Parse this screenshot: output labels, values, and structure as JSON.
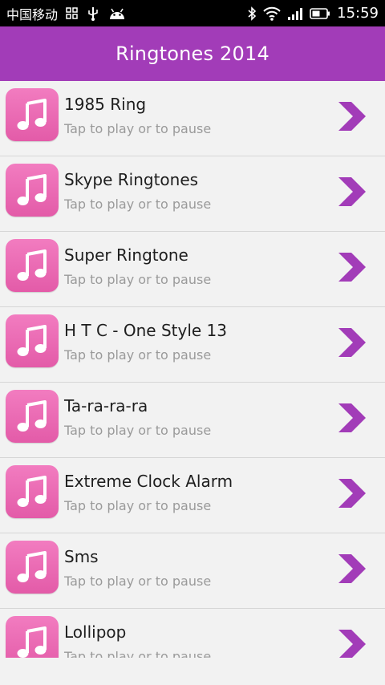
{
  "status_bar": {
    "carrier": "中国移动",
    "time": "15:59",
    "left_icons": [
      "notification-grid-icon",
      "usb-icon",
      "android-icon"
    ],
    "right_icons": [
      "bluetooth-icon",
      "wifi-icon",
      "signal-icon",
      "battery-icon"
    ]
  },
  "app_bar": {
    "title": "Ringtones 2014",
    "color": "#a23cb8"
  },
  "list": {
    "items": [
      {
        "title": "1985 Ring",
        "subtitle": "Tap to play or to pause"
      },
      {
        "title": "Skype Ringtones",
        "subtitle": "Tap to play or to pause"
      },
      {
        "title": "Super Ringtone",
        "subtitle": "Tap to play or to pause"
      },
      {
        "title": "H T C - One Style 13",
        "subtitle": "Tap to play or to pause"
      },
      {
        "title": "Ta-ra-ra-ra",
        "subtitle": "Tap to play or to pause"
      },
      {
        "title": "Extreme Clock Alarm",
        "subtitle": "Tap to play or to pause"
      },
      {
        "title": "Sms",
        "subtitle": "Tap to play or to pause"
      },
      {
        "title": "Lollipop",
        "subtitle": "Tap to play or to pause"
      }
    ],
    "item_icon": "music-note-icon",
    "chevron_icon": "chevron-right-icon",
    "icon_color": "#e866b3",
    "chevron_color": "#a23cb8"
  }
}
